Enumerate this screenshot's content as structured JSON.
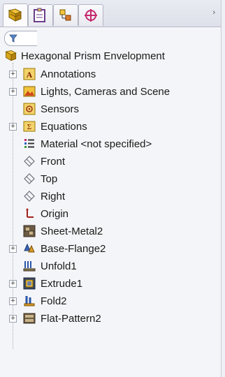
{
  "tabs": [
    {
      "name": "featuremanager-tab-icon"
    },
    {
      "name": "propertymanager-tab-icon"
    },
    {
      "name": "configurationmanager-tab-icon"
    },
    {
      "name": "dimxpert-tab-icon"
    }
  ],
  "filter": {
    "icon": "filter-icon"
  },
  "tree": {
    "root": "Hexagonal Prism Envelopment",
    "items": [
      {
        "label": "Annotations",
        "expandable": true,
        "icon": "annotations-icon"
      },
      {
        "label": "Lights, Cameras and Scene",
        "expandable": true,
        "icon": "lights-cameras-scene-icon"
      },
      {
        "label": "Sensors",
        "expandable": false,
        "icon": "sensors-icon"
      },
      {
        "label": "Equations",
        "expandable": true,
        "icon": "equations-icon"
      },
      {
        "label": "Material <not specified>",
        "expandable": false,
        "icon": "material-icon"
      },
      {
        "label": "Front",
        "expandable": false,
        "icon": "plane-icon"
      },
      {
        "label": "Top",
        "expandable": false,
        "icon": "plane-icon"
      },
      {
        "label": "Right",
        "expandable": false,
        "icon": "plane-icon"
      },
      {
        "label": "Origin",
        "expandable": false,
        "icon": "origin-icon"
      },
      {
        "label": "Sheet-Metal2",
        "expandable": false,
        "icon": "sheet-metal-icon"
      },
      {
        "label": "Base-Flange2",
        "expandable": true,
        "icon": "base-flange-icon"
      },
      {
        "label": "Unfold1",
        "expandable": false,
        "icon": "unfold-icon"
      },
      {
        "label": "Extrude1",
        "expandable": true,
        "icon": "extrude-icon"
      },
      {
        "label": "Fold2",
        "expandable": true,
        "icon": "fold-icon"
      },
      {
        "label": "Flat-Pattern2",
        "expandable": true,
        "icon": "flat-pattern-icon"
      }
    ]
  }
}
